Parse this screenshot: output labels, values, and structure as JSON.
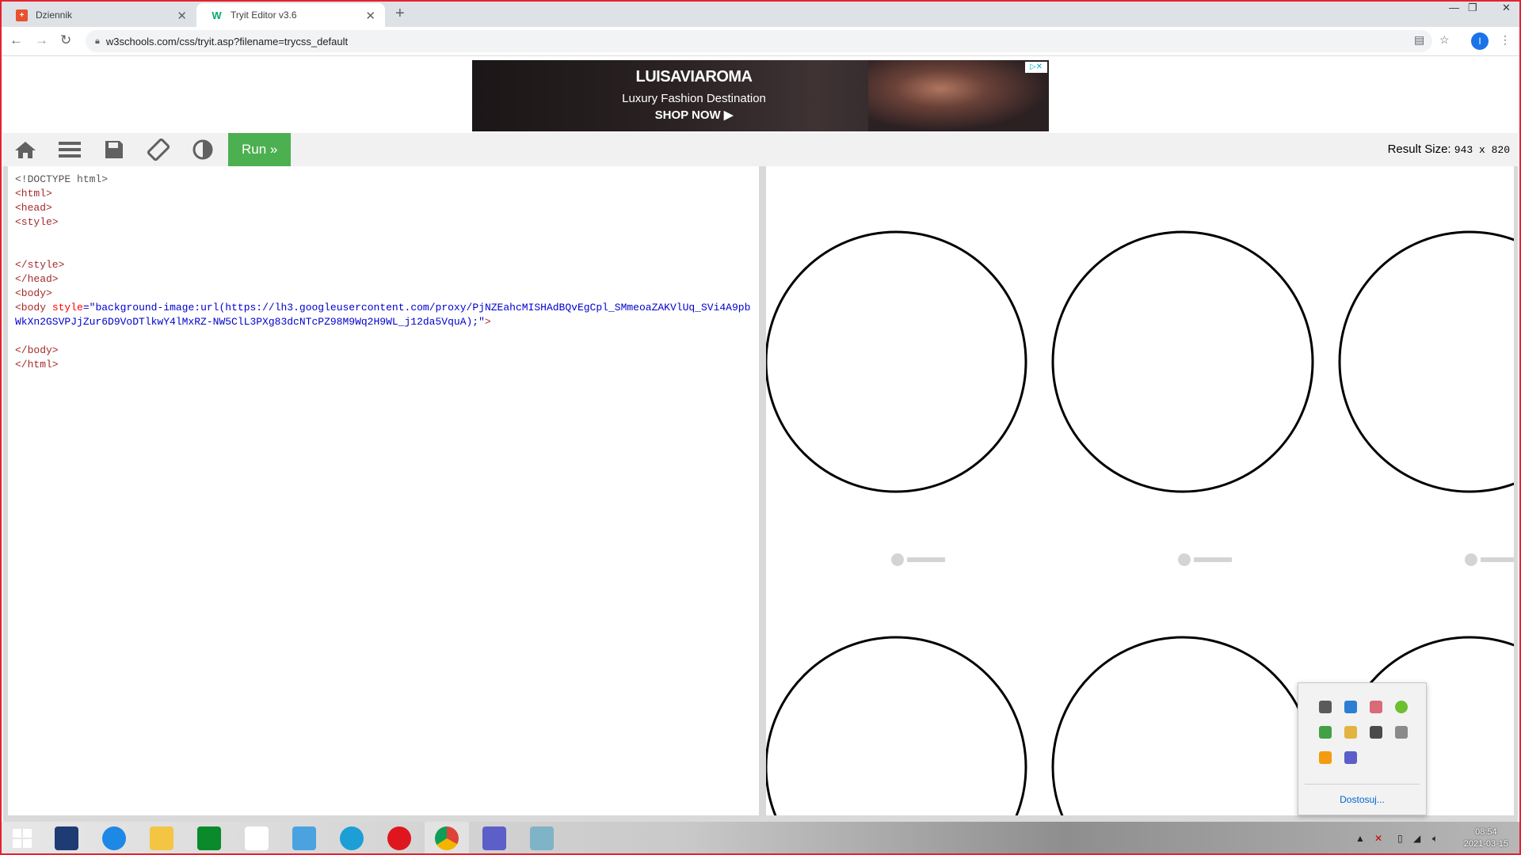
{
  "browser": {
    "tabs": [
      {
        "title": "Dziennik",
        "icon": "dziennik-favicon"
      },
      {
        "title": "Tryit Editor v3.6",
        "icon": "w3schools-favicon",
        "active": true
      }
    ],
    "url": "w3schools.com/css/tryit.asp?filename=trycss_default",
    "profile_initial": "I"
  },
  "ad": {
    "brand": "LUISAVIAROMA",
    "tagline": "Luxury Fashion Destination",
    "cta": "SHOP NOW ▶"
  },
  "editor": {
    "run_label": "Run »",
    "result_size_label": "Result Size:",
    "result_size_value": "943 x 820",
    "code_lines": {
      "l1": "<!DOCTYPE html>",
      "l2": "<html>",
      "l3": "<head>",
      "l4": "<style>",
      "l5": "</style>",
      "l6": "</head>",
      "l7": "<body>",
      "l8_tag": "<body",
      "l8_attr": "style",
      "l8_value": "\"background-image:url(https://lh3.googleusercontent.com/proxy/PjNZEahcMISHAdBQvEgCpl_SMmeoaZAKVlUq_SVi4A9pbWkXn2GSVPJjZur6D9VoDTlkwY4lMxRZ-NW5ClL3PXg83dcNTcPZ98M9Wq2H9WL_j12da5VquA);\"",
      "l8_end": ">",
      "l9": "</body>",
      "l10": "</html>"
    }
  },
  "tray": {
    "customize_label": "Dostosuj..."
  },
  "clock": {
    "time": "08:54",
    "date": "2021-03-15"
  },
  "colors": {
    "run_green": "#4caf50",
    "frame_red": "#e4222e",
    "accent_blue": "#1a73e8"
  }
}
